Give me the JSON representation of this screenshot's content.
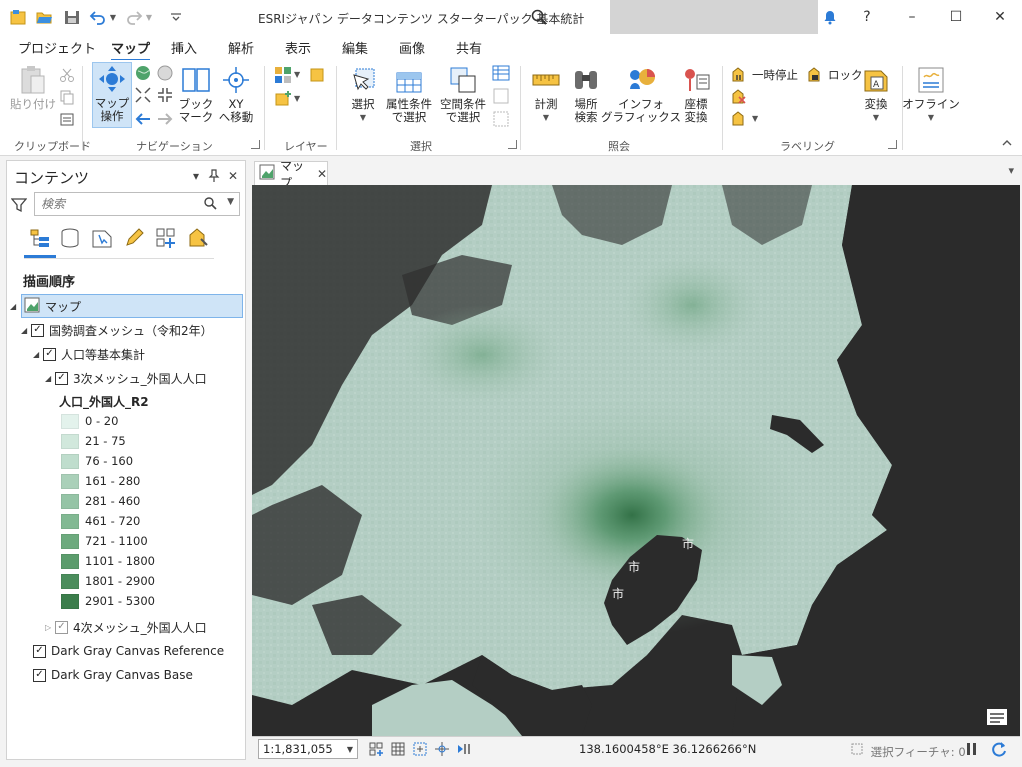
{
  "app": {
    "title": "ESRIジャパン データコンテンツ スターターパック 基本統計"
  },
  "window_controls": {
    "help": "?",
    "minimize": "–",
    "maximize": "☐",
    "close": "✕"
  },
  "ribbon_tabs": [
    "プロジェクト",
    "マップ",
    "挿入",
    "解析",
    "表示",
    "編集",
    "画像",
    "共有"
  ],
  "ribbon_active_tab": "マップ",
  "ribbon": {
    "clipboard": {
      "paste": "貼り付け",
      "group_label": "クリップボード"
    },
    "navigation": {
      "explore_line1": "マップ",
      "explore_line2": "操作",
      "bookmarks_line1": "ブック",
      "bookmarks_line2": "マーク",
      "goto_line1": "XY",
      "goto_line2": "へ移動",
      "group_label": "ナビゲーション"
    },
    "layer": {
      "group_label": "レイヤー"
    },
    "selection": {
      "select": "選択",
      "attr_line1": "属性条件",
      "attr_line2": "で選択",
      "loc_line1": "空間条件",
      "loc_line2": "で選択",
      "group_label": "選択"
    },
    "inquiry": {
      "measure": "計測",
      "locate_line1": "場所",
      "locate_line2": "検索",
      "infographics_line1": "インフォ",
      "infographics_line2": "グラフィックス",
      "convert_line1": "座標",
      "convert_line2": "変換",
      "group_label": "照会"
    },
    "labeling": {
      "pause": "一時停止",
      "lock": "ロック",
      "convert": "変換",
      "group_label": "ラベリング"
    },
    "offline": {
      "offline": "オフライン"
    }
  },
  "contents": {
    "title": "コンテンツ",
    "search_placeholder": "検索",
    "draw_order": "描画順序",
    "map_name": "マップ",
    "layers": {
      "census_group": "国勢調査メッシュ（令和2年）",
      "pop_group": "人口等基本集計",
      "mesh3": "3次メッシュ_外国人人口",
      "field_name": "人口_外国人_R2",
      "mesh4": "4次メッシュ_外国人人口",
      "reference": "Dark Gray Canvas Reference",
      "base": "Dark Gray Canvas Base"
    },
    "legend": [
      {
        "label": "0 - 20",
        "color": "#e3f2ec"
      },
      {
        "label": "21 - 75",
        "color": "#d1e8dc"
      },
      {
        "label": "76 - 160",
        "color": "#bfddcd"
      },
      {
        "label": "161 - 280",
        "color": "#aad0b9"
      },
      {
        "label": "281 - 460",
        "color": "#95c4a6"
      },
      {
        "label": "461 - 720",
        "color": "#82b993"
      },
      {
        "label": "721 - 1100",
        "color": "#6daa7e"
      },
      {
        "label": "1101 - 1800",
        "color": "#5b9c6c"
      },
      {
        "label": "1801 - 2900",
        "color": "#4b8d5c"
      },
      {
        "label": "2901 - 5300",
        "color": "#3b7d4b"
      }
    ]
  },
  "map_view": {
    "tab_label": "マップ",
    "scale": "1:1,831,055",
    "coordinates": "138.1600458°E 36.1266266°N",
    "selected_features": "選択フィーチャ: 0",
    "place_labels": [
      "市",
      "市",
      "市"
    ]
  },
  "colors": {
    "accent": "#2c7bd6",
    "map_background": "#2b2b2b",
    "land": "#b4cec4"
  }
}
